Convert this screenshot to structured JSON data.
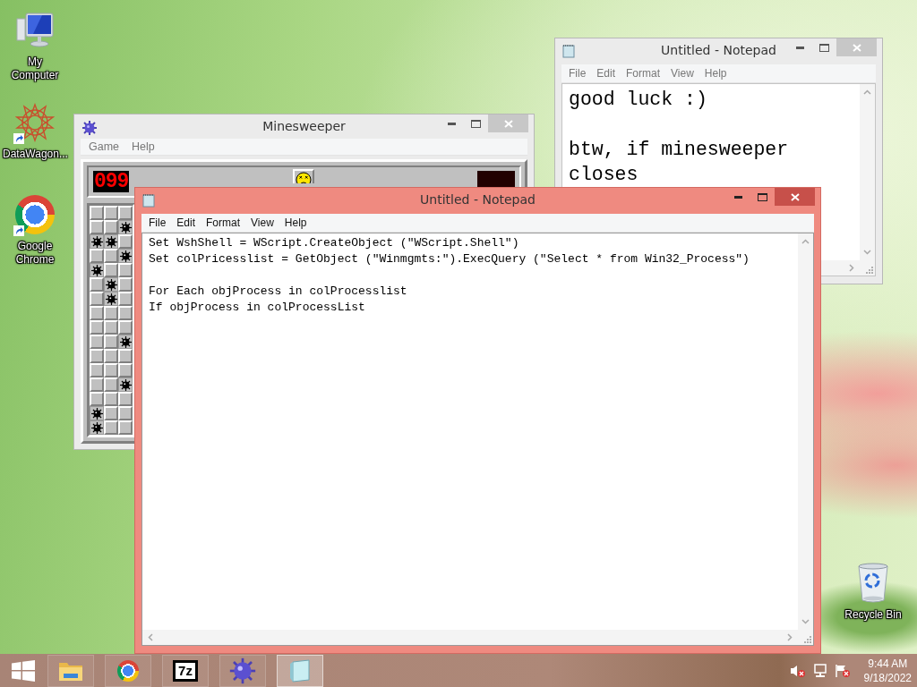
{
  "desktop": {
    "icons": [
      {
        "label": "My Computer",
        "kind": "computer",
        "shortcut": false
      },
      {
        "label": "DataWagon...",
        "kind": "datawagon",
        "shortcut": true
      },
      {
        "label": "Google Chrome",
        "kind": "chrome",
        "shortcut": true
      }
    ],
    "recycle_bin": {
      "label": "Recycle Bin"
    }
  },
  "minesweeper": {
    "title": "Minesweeper",
    "active": false,
    "menu": [
      "Game",
      "Help"
    ],
    "mine_counter": "099",
    "grid": [
      [
        false,
        false,
        false
      ],
      [
        false,
        false,
        true
      ],
      [
        true,
        true,
        false
      ],
      [
        false,
        false,
        true
      ],
      [
        true,
        false,
        false
      ],
      [
        false,
        true,
        false
      ],
      [
        false,
        true,
        false
      ],
      [
        false,
        false,
        false
      ],
      [
        false,
        false,
        false
      ],
      [
        false,
        false,
        true
      ],
      [
        false,
        false,
        false
      ],
      [
        false,
        false,
        false
      ],
      [
        false,
        false,
        true
      ],
      [
        false,
        false,
        false
      ],
      [
        true,
        false,
        false
      ],
      [
        true,
        false,
        false
      ]
    ]
  },
  "notepad_back": {
    "title": "Untitled - Notepad",
    "active": false,
    "menu": [
      "File",
      "Edit",
      "Format",
      "View",
      "Help"
    ],
    "paragraphs": [
      [
        "good luck :)"
      ],
      [
        "btw, if minesweeper",
        "closes"
      ]
    ]
  },
  "notepad_front": {
    "title": "Untitled - Notepad",
    "active": true,
    "menu": [
      "File",
      "Edit",
      "Format",
      "View",
      "Help"
    ],
    "paragraphs": [
      [
        "Set WshShell = WScript.CreateObject (\"WScript.Shell\")",
        "Set colPricesslist = GetObject (\"Winmgmts:\").ExecQuery (\"Select * from Win32_Process\")"
      ],
      [
        "For Each objProcess in colProcesslist",
        "If objProcess in colProcessList"
      ]
    ]
  },
  "taskbar": {
    "buttons": [
      {
        "kind": "explorer",
        "active": false
      },
      {
        "kind": "chrome",
        "active": false
      },
      {
        "kind": "sevenzip",
        "text": "7z",
        "active": false
      },
      {
        "kind": "minesweeper",
        "active": false
      },
      {
        "kind": "notepad",
        "active": true
      }
    ],
    "tray": {
      "time": "9:44 AM",
      "date": "9/18/2022"
    }
  }
}
